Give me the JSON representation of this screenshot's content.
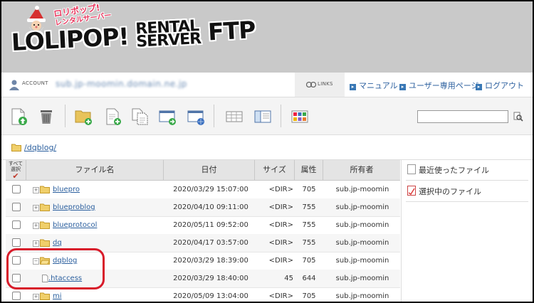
{
  "header": {
    "logo_badge_line1": "ロリポップ!",
    "logo_badge_line2": "レンタルサーバー",
    "logo_lolipop": "LOLIPOP!",
    "logo_rental": "RENTAL",
    "logo_server": "SERVER",
    "logo_ftp": "FTP"
  },
  "account": {
    "label": "ACCOUNT",
    "name": "sub.jp-moomin.domain.ne.jp",
    "links_label": "LINKS",
    "links": [
      "マニュアル",
      "ユーザー専用ページ",
      "ログアウト"
    ]
  },
  "toolbar": {
    "search_value": ""
  },
  "path": {
    "current": "/dqblog/"
  },
  "table": {
    "select_all_line1": "すべて",
    "select_all_line2": "選択",
    "select_all_check": "✔",
    "headers": {
      "name": "ファイル名",
      "date": "日付",
      "size": "サイズ",
      "perm": "属性",
      "owner": "所有者"
    },
    "rows": [
      {
        "expander": "+",
        "name": "bluepro",
        "date": "2020/03/29 15:07:00",
        "size": "<DIR>",
        "perm": "705",
        "owner": "sub.jp-moomin"
      },
      {
        "expander": "+",
        "name": "blueproblog",
        "date": "2020/04/10 09:11:00",
        "size": "<DIR>",
        "perm": "755",
        "owner": "sub.jp-moomin"
      },
      {
        "expander": "+",
        "name": "blueprotocol",
        "date": "2020/05/11 09:52:00",
        "size": "<DIR>",
        "perm": "755",
        "owner": "sub.jp-moomin"
      },
      {
        "expander": "+",
        "name": "dq",
        "date": "2020/04/17 03:57:00",
        "size": "<DIR>",
        "perm": "755",
        "owner": "sub.jp-moomin"
      },
      {
        "expander": "−",
        "name": "dqblog",
        "date": "2020/03/29 18:39:00",
        "size": "<DIR>",
        "perm": "705",
        "owner": "sub.jp-moomin"
      },
      {
        "expander": "",
        "name": ".htaccess",
        "date": "2020/03/29 18:40:00",
        "size": "45",
        "perm": "644",
        "owner": "sub.jp-moomin"
      },
      {
        "expander": "+",
        "name": "mi",
        "date": "2020/05/09 13:04:00",
        "size": "<DIR>",
        "perm": "705",
        "owner": "sub.jp-moomin"
      }
    ]
  },
  "side_panel": {
    "recent_files": "最近使ったファイル",
    "selected_files": "選択中のファイル"
  },
  "colors": {
    "link": "#2b5f9e",
    "annotation": "#d81b2a",
    "header_bg": "#c9c9c9"
  }
}
